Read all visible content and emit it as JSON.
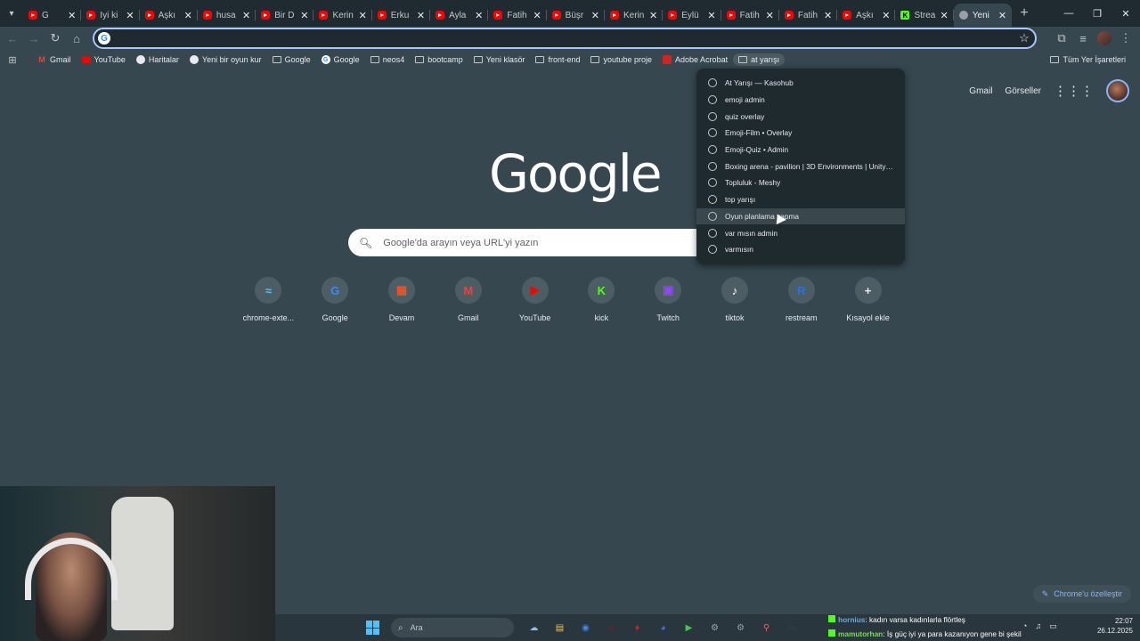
{
  "tabs": [
    {
      "label": "G",
      "icon": "youtube-icon"
    },
    {
      "label": "İyi ki",
      "icon": "youtube-icon"
    },
    {
      "label": "Aşkı",
      "icon": "youtube-icon"
    },
    {
      "label": "husa",
      "icon": "youtube-icon"
    },
    {
      "label": "Bir D",
      "icon": "youtube-icon"
    },
    {
      "label": "Kerin",
      "icon": "youtube-icon"
    },
    {
      "label": "Erku",
      "icon": "youtube-icon"
    },
    {
      "label": "Ayla",
      "icon": "youtube-icon"
    },
    {
      "label": "Fatih",
      "icon": "youtube-icon"
    },
    {
      "label": "Büşr",
      "icon": "youtube-icon"
    },
    {
      "label": "Kerin",
      "icon": "youtube-icon"
    },
    {
      "label": "Eylü",
      "icon": "youtube-icon"
    },
    {
      "label": "Fatih",
      "icon": "youtube-icon"
    },
    {
      "label": "Fatih",
      "icon": "youtube-icon"
    },
    {
      "label": "Aşkı",
      "icon": "youtube-icon"
    },
    {
      "label": "Strea",
      "icon": "kick-icon"
    },
    {
      "label": "Yeni",
      "icon": "globe-icon"
    }
  ],
  "omnibox": {
    "value": "",
    "placeholder": ""
  },
  "bookmarks": [
    {
      "label": "Gmail",
      "icon": "gmail-icon"
    },
    {
      "label": "YouTube",
      "icon": "youtube-icon"
    },
    {
      "label": "Haritalar",
      "icon": "maps-icon"
    },
    {
      "label": "Yeni bir oyun kur",
      "icon": "page-icon"
    },
    {
      "label": "Google",
      "icon": "folder-icon"
    },
    {
      "label": "Google",
      "icon": "google-icon"
    },
    {
      "label": "neos4",
      "icon": "folder-icon"
    },
    {
      "label": "bootcamp",
      "icon": "folder-icon"
    },
    {
      "label": "Yeni klasör",
      "icon": "folder-icon"
    },
    {
      "label": "front-end",
      "icon": "folder-icon"
    },
    {
      "label": "youtube proje",
      "icon": "folder-icon"
    },
    {
      "label": "Adobe Acrobat",
      "icon": "acrobat-icon"
    },
    {
      "label": "at yarışı",
      "icon": "folder-icon"
    }
  ],
  "all_bookmarks": "Tüm Yer İşaretleri",
  "header_links": {
    "gmail": "Gmail",
    "images": "Görseller"
  },
  "logo_text": "Google",
  "search": {
    "placeholder": "Google'da arayın veya URL'yi yazın"
  },
  "shortcuts": [
    {
      "label": "chrome-exte...",
      "glyph": "≈",
      "color": "#4fc3f7"
    },
    {
      "label": "Google",
      "glyph": "G",
      "color": "#4285f4"
    },
    {
      "label": "Devam",
      "glyph": "▦",
      "color": "#f25022"
    },
    {
      "label": "Gmail",
      "glyph": "M",
      "color": "#ea4335"
    },
    {
      "label": "YouTube",
      "glyph": "▶",
      "color": "#ff0000"
    },
    {
      "label": "kick",
      "glyph": "K",
      "color": "#53fc18"
    },
    {
      "label": "Twitch",
      "glyph": "▣",
      "color": "#9146ff"
    },
    {
      "label": "tiktok",
      "glyph": "♪",
      "color": "#ffffff"
    },
    {
      "label": "restream",
      "glyph": "R",
      "color": "#2e6fd8"
    },
    {
      "label": "Kısayol ekle",
      "glyph": "+",
      "color": "#e8eaed"
    }
  ],
  "folder_menu": [
    "At Yarışı — Kasohub",
    "emoji admin",
    "quiz overlay",
    "Emoji-Film • Overlay",
    "Emoji-Quiz • Admin",
    "Boxing arena - pavilion | 3D Environments | Unity As...",
    "Topluluk - Meshy",
    "top yarışı",
    "Oyun planlama yapma",
    "var mısın admin",
    "varmısın"
  ],
  "customize_label": "Chrome'u özelleştir",
  "taskbar": {
    "search_placeholder": "Ara",
    "apps": [
      "weather",
      "file-explorer",
      "chrome",
      "obs",
      "red-app",
      "discord",
      "green-app",
      "steam",
      "settings",
      "maps-pin",
      "terminal"
    ]
  },
  "chat": [
    {
      "user": "hornius",
      "message": ": kadın varsa kadınlarla flörtleş"
    },
    {
      "user": "mamutorhan",
      "message": ": İş güç iyi ya para kazanıyon gene bi şekil"
    }
  ],
  "clock": {
    "time": "22:07",
    "date": "26.12.2025"
  },
  "colors": {
    "page_bg": "#36474f",
    "tabstrip_bg": "#1f2b30",
    "accent": "#a8c7fa",
    "menu_bg": "#1f2a2f"
  }
}
